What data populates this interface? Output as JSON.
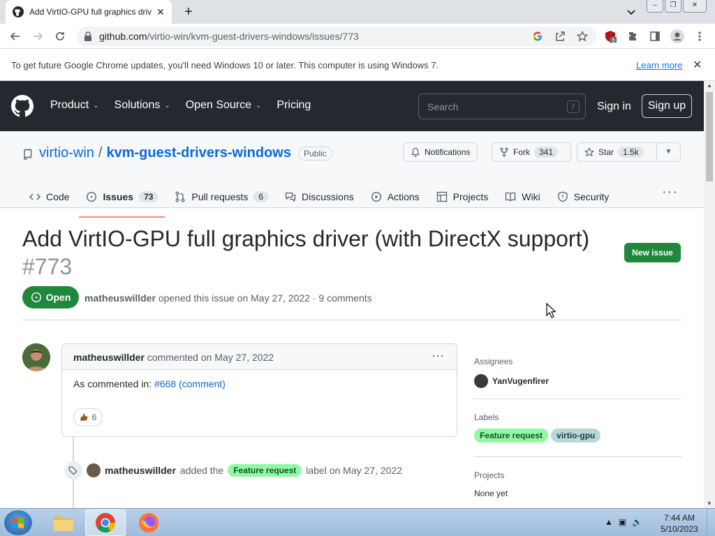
{
  "browser": {
    "tab_title": "Add VirtIO-GPU full graphics driv",
    "tab_close": "✕",
    "new_tab": "+",
    "url_host": "github.com",
    "url_path": "/virtio-win/kvm-guest-drivers-windows/issues/773",
    "extension_badge": "6",
    "infobar_message": "To get future Google Chrome updates, you'll need Windows 10 or later. This computer is using Windows 7.",
    "infobar_link": "Learn more",
    "infobar_close": "✕"
  },
  "gh_header": {
    "nav": [
      {
        "label": "Product",
        "caret": true
      },
      {
        "label": "Solutions",
        "caret": true
      },
      {
        "label": "Open Source",
        "caret": true
      },
      {
        "label": "Pricing",
        "caret": false
      }
    ],
    "search_placeholder": "Search",
    "search_key": "/",
    "sign_in": "Sign in",
    "sign_up": "Sign up"
  },
  "repo": {
    "owner": "virtio-win",
    "separator": "/",
    "name": "kvm-guest-drivers-windows",
    "visibility": "Public",
    "notifications_label": "Notifications",
    "fork_label": "Fork",
    "fork_count": "341",
    "star_label": "Star",
    "star_count": "1.5k",
    "tabs": [
      {
        "label": "Code",
        "count": null
      },
      {
        "label": "Issues",
        "count": "73"
      },
      {
        "label": "Pull requests",
        "count": "6"
      },
      {
        "label": "Discussions",
        "count": null
      },
      {
        "label": "Actions",
        "count": null
      },
      {
        "label": "Projects",
        "count": null
      },
      {
        "label": "Wiki",
        "count": null
      },
      {
        "label": "Security",
        "count": null
      }
    ],
    "more": "···"
  },
  "issue": {
    "title": "Add VirtIO-GPU full graphics driver (with DirectX support)",
    "number": "#773",
    "new_issue_label": "New issue",
    "state": "Open",
    "author": "matheuswillder",
    "opened_text": "opened this issue on May 27, 2022 · 9 comments"
  },
  "comment": {
    "author": "matheuswillder",
    "action": "commented on May 27, 2022",
    "menu": "···",
    "body_prefix": "As commented in:",
    "body_link": "#668 (comment)",
    "reaction_count": "6"
  },
  "event": {
    "author": "matheuswillder",
    "pre": "added the",
    "label": "Feature request",
    "post": "label on May 27, 2022"
  },
  "sidebar": {
    "assignees_heading": "Assignees",
    "assignee": "YanVugenfirer",
    "labels_heading": "Labels",
    "labels": [
      {
        "name": "Feature request",
        "color": "#90f9a4"
      },
      {
        "name": "virtio-gpu",
        "color": "#b7d7d8"
      }
    ],
    "projects_heading": "Projects",
    "projects_value": "None yet"
  },
  "taskbar": {
    "time": "7:44 AM",
    "date": "5/10/2023"
  },
  "colors": {
    "header_bg": "#24292f",
    "link": "#0969da",
    "green": "#1f883d",
    "tab_underline": "#fd8c73"
  }
}
